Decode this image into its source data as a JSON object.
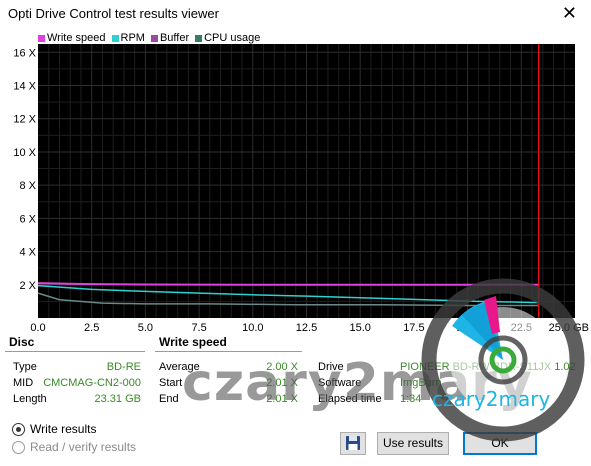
{
  "window": {
    "title": "Opti Drive Control test results viewer",
    "close_glyph": "✕"
  },
  "legend": [
    {
      "label": "Write speed",
      "color": "#e040e0"
    },
    {
      "label": "RPM",
      "color": "#30d0d0"
    },
    {
      "label": "Buffer",
      "color": "#9a4aa0"
    },
    {
      "label": "CPU usage",
      "color": "#3a7a6a"
    }
  ],
  "chart_data": {
    "type": "line",
    "x_ticks": [
      "0.0",
      "2.5",
      "5.0",
      "7.5",
      "10.0",
      "12.5",
      "15.0",
      "17.5",
      "20.0",
      "22.5",
      "25.0 GB"
    ],
    "y_ticks": [
      "2 X",
      "4 X",
      "6 X",
      "8 X",
      "10 X",
      "12 X",
      "14 X",
      "16 X"
    ],
    "xlim": [
      0,
      25
    ],
    "ylim": [
      0,
      16.5
    ],
    "marker_x": 23.31,
    "series": [
      {
        "name": "Write speed",
        "color": "#e040e0",
        "x": [
          0,
          2,
          5,
          10,
          15,
          20,
          23.3
        ],
        "y": [
          2.1,
          2.05,
          2.02,
          2.0,
          2.0,
          2.0,
          2.0
        ]
      },
      {
        "name": "RPM",
        "color": "#30d0d0",
        "x": [
          0,
          2.5,
          5,
          7.5,
          10,
          12.5,
          15,
          17.5,
          20,
          22.5,
          23.3
        ],
        "y": [
          1.95,
          1.72,
          1.6,
          1.5,
          1.4,
          1.32,
          1.22,
          1.12,
          1.02,
          0.95,
          0.93
        ]
      },
      {
        "name": "CPU usage",
        "color": "#6a8a88",
        "x": [
          0,
          1,
          3,
          5,
          8,
          12,
          16,
          20,
          23.3
        ],
        "y": [
          1.5,
          1.1,
          0.9,
          0.85,
          0.85,
          0.8,
          0.8,
          0.75,
          0.75
        ]
      }
    ]
  },
  "disc": {
    "heading": "Disc",
    "type_label": "Type",
    "type_value": "BD-RE",
    "mid_label": "MID",
    "mid_value": "CMCMAG-CN2-000",
    "length_label": "Length",
    "length_value": "23.31 GB"
  },
  "write_speed": {
    "heading": "Write speed",
    "average_label": "Average",
    "average_value": "2.00 X",
    "start_label": "Start",
    "start_value": "2.01 X",
    "end_label": "End",
    "end_value": "2.01 X"
  },
  "info": {
    "drive_label": "Drive",
    "drive_value": "PIONEER  BD-RW   BDR-S11JX 1.02",
    "software_label": "Software",
    "software_value": "ImgBurn",
    "elapsed_label": "Elapsed time",
    "elapsed_value": "1:34"
  },
  "options": {
    "write_results": "Write results",
    "read_verify_results": "Read / verify results"
  },
  "buttons": {
    "use_results": "Use results",
    "ok": "OK"
  },
  "watermark": {
    "text": "czary2mary",
    "logo_text": "czary2mary"
  }
}
